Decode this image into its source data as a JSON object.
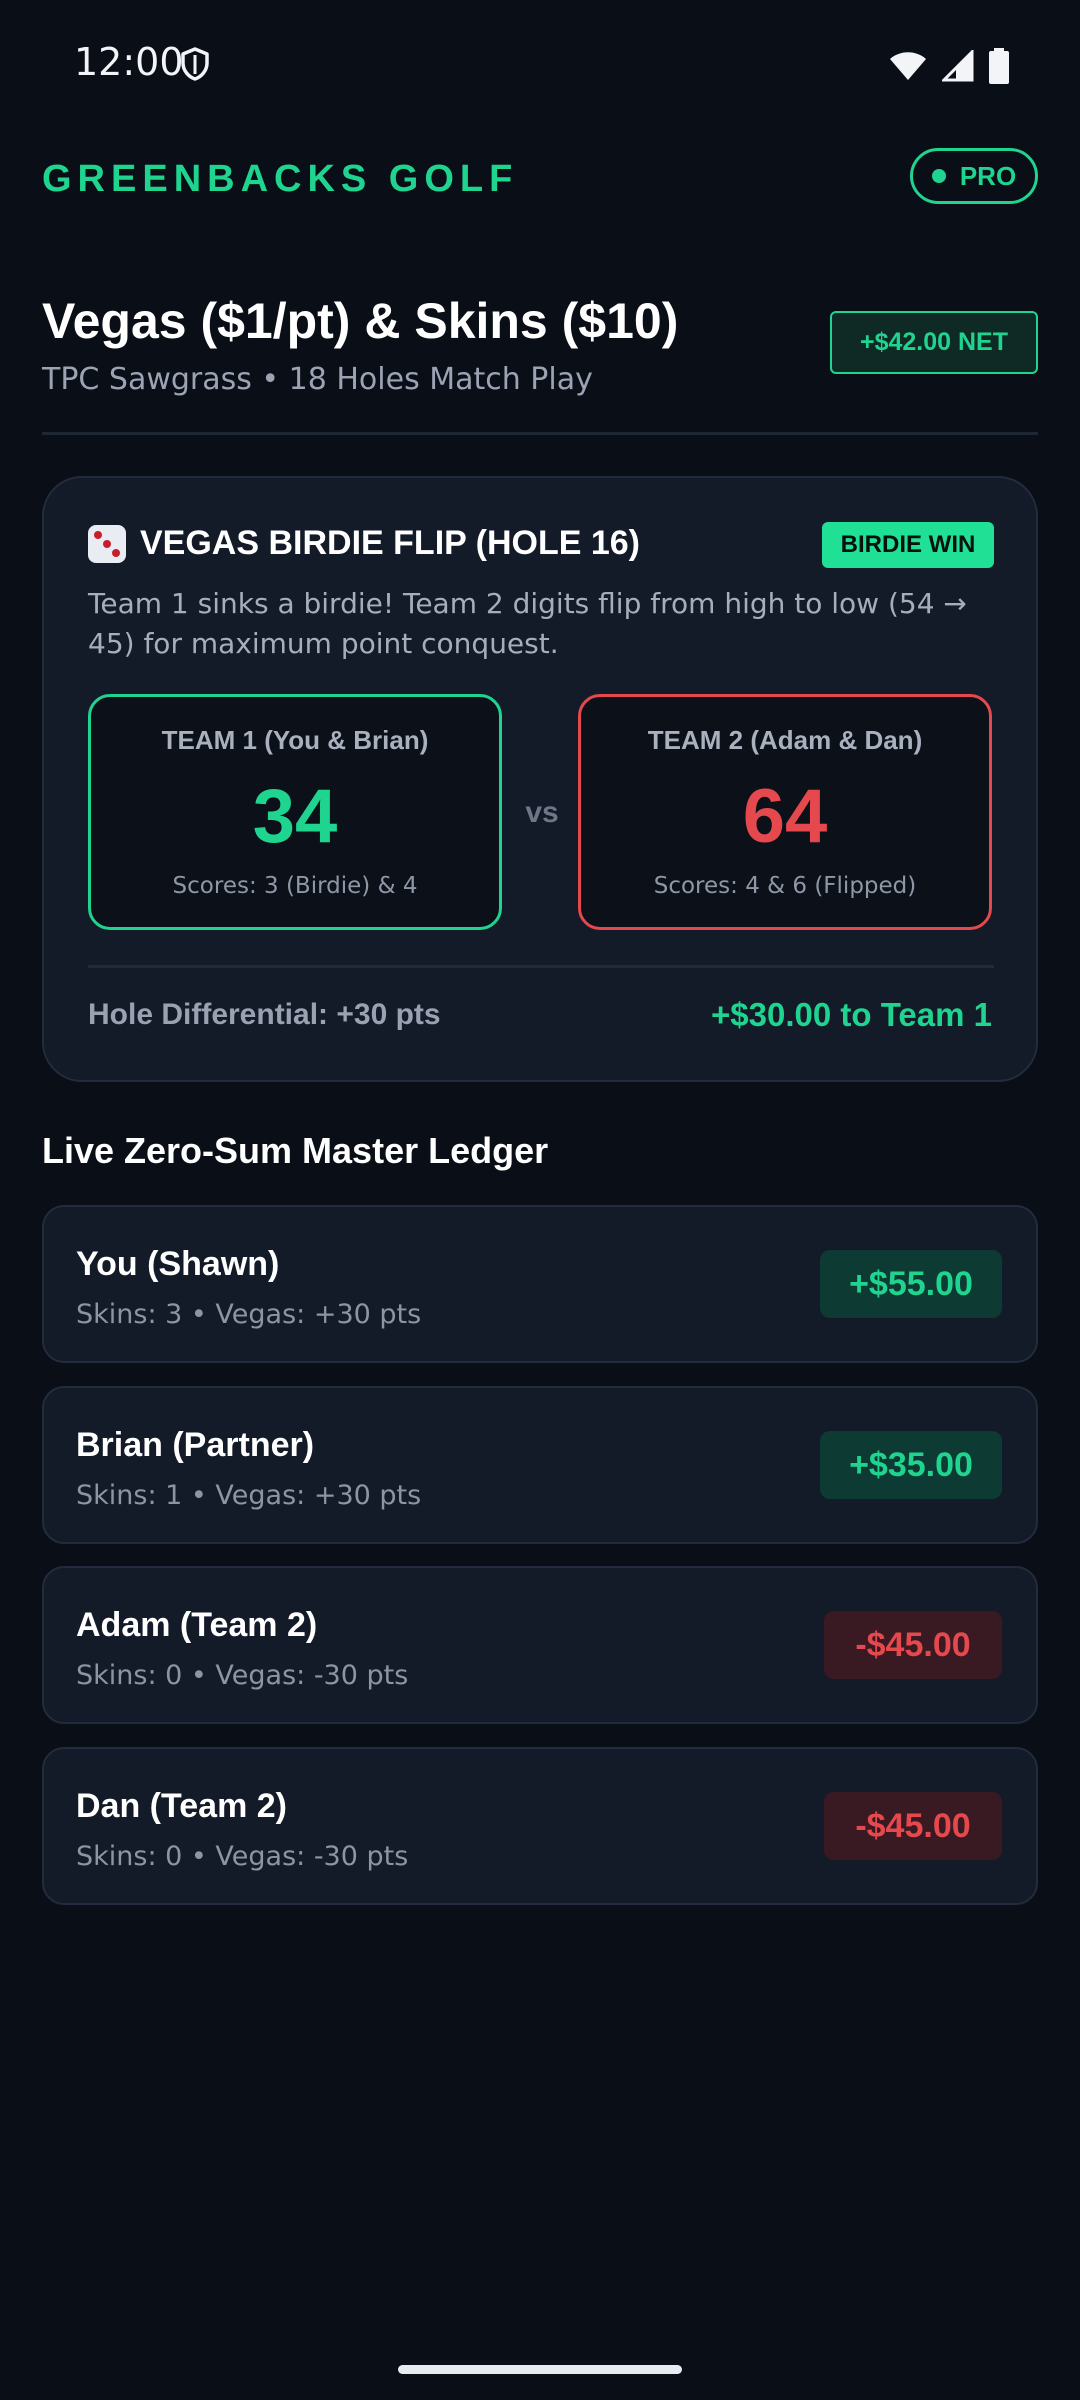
{
  "status_bar": {
    "time": "12:00",
    "icons": [
      "shield-icon",
      "wifi-icon",
      "signal-icon",
      "battery-icon"
    ]
  },
  "app": {
    "name": "GREENBACKS GOLF",
    "badge": "PRO"
  },
  "match": {
    "title": "Vegas ($1/pt) & Skins ($10)",
    "subtitle": "TPC Sawgrass • 18 Holes Match Play",
    "net": "+$42.00 NET"
  },
  "flip_card": {
    "icon": "dice-icon",
    "title": "VEGAS BIRDIE FLIP (HOLE 16)",
    "badge": "BIRDIE WIN",
    "description": "Team 1 sinks a birdie! Team 2 digits flip from high to low (54 → 45) for maximum point conquest.",
    "vs": "vs",
    "team1": {
      "name": "TEAM 1 (You & Brian)",
      "score": "34",
      "note": "Scores: 3 (Birdie) & 4"
    },
    "team2": {
      "name": "TEAM 2 (Adam & Dan)",
      "score": "64",
      "note": "Scores: 4 & 6 (Flipped)"
    },
    "differential": "Hole Differential: +30 pts",
    "payout": "+$30.00 to Team 1"
  },
  "ledger": {
    "title": "Live Zero-Sum Master Ledger",
    "rows": [
      {
        "name": "You (Shawn)",
        "stats": "Skins: 3 • Vegas: +30 pts",
        "amount": "+$55.00"
      },
      {
        "name": "Brian (Partner)",
        "stats": "Skins: 1 • Vegas: +30 pts",
        "amount": "+$35.00"
      },
      {
        "name": "Adam (Team 2)",
        "stats": "Skins: 0 • Vegas: -30 pts",
        "amount": "-$45.00"
      },
      {
        "name": "Dan (Team 2)",
        "stats": "Skins: 0 • Vegas: -30 pts",
        "amount": "-$45.00"
      }
    ]
  },
  "colors": {
    "background": "#0a0e17",
    "accent_green": "#1fd48f",
    "accent_red": "#e5484d",
    "card": "#131a28"
  }
}
